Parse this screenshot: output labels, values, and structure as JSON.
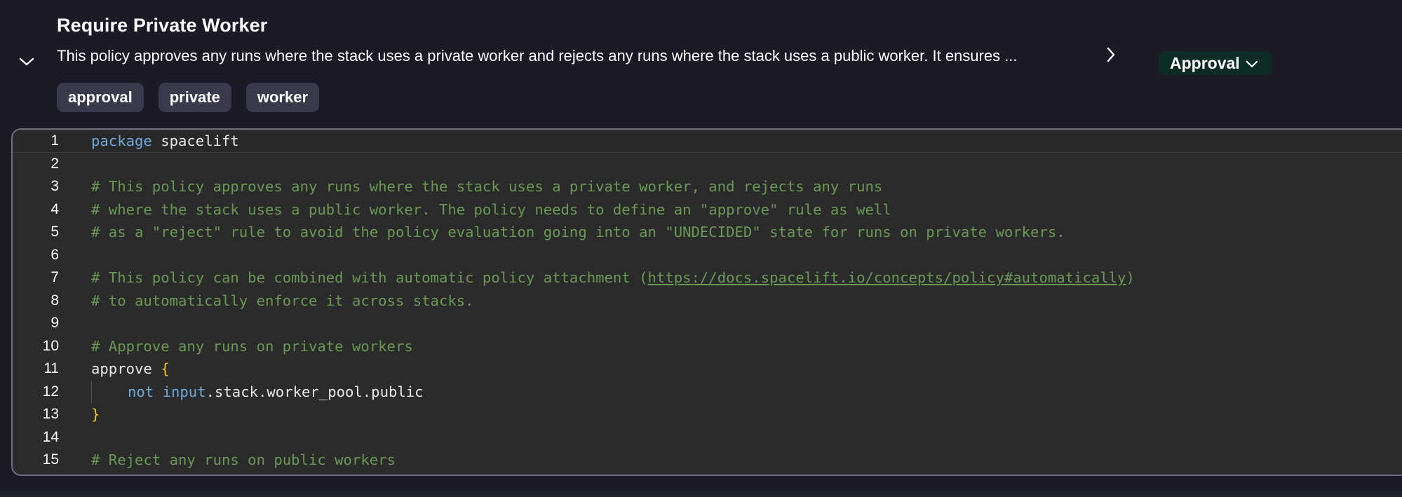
{
  "policy": {
    "title": "Require Private Worker",
    "description": "This policy approves any runs where the stack uses a private worker and rejects any runs where the stack uses a public worker. It ensures ...",
    "type_label": "Approval",
    "tags": [
      "approval",
      "private",
      "worker"
    ]
  },
  "icons": {
    "toggle": "chevron-down-icon",
    "expand": "chevron-right-icon",
    "type_dropdown": "chevron-down-icon"
  },
  "colors": {
    "background": "#1b1a26",
    "editor_bg": "#2b2b2b",
    "badge_bg": "#0c2c24",
    "tag_bg": "#3a3a4d",
    "keyword": "#6fa8dc",
    "comment": "#6a9955",
    "brace": "#f5c518"
  },
  "editor": {
    "line_numbers": [
      "1",
      "2",
      "3",
      "4",
      "5",
      "6",
      "7",
      "8",
      "9",
      "10",
      "11",
      "12",
      "13",
      "14",
      "15"
    ],
    "lines": {
      "l1_kw": "package",
      "l1_rest": " spacelift",
      "l3": "# This policy approves any runs where the stack uses a private worker, and rejects any runs",
      "l4": "# where the stack uses a public worker. The policy needs to define an \"approve\" rule as well",
      "l5": "# as a \"reject\" rule to avoid the policy evaluation going into an \"UNDECIDED\" state for runs on private workers.",
      "l7_pre": "# This policy can be combined with automatic policy attachment (",
      "l7_link": "https://docs.spacelift.io/concepts/policy#automatically",
      "l7_post": ")",
      "l8": "# to automatically enforce it across stacks.",
      "l10": "# Approve any runs on private workers",
      "l11_name": "approve ",
      "l11_brace": "{",
      "l12_kw1": "not",
      "l12_kw2": "input",
      "l12_rest": ".stack.worker_pool.public",
      "l13_brace": "}",
      "l15": "# Reject any runs on public workers"
    }
  }
}
